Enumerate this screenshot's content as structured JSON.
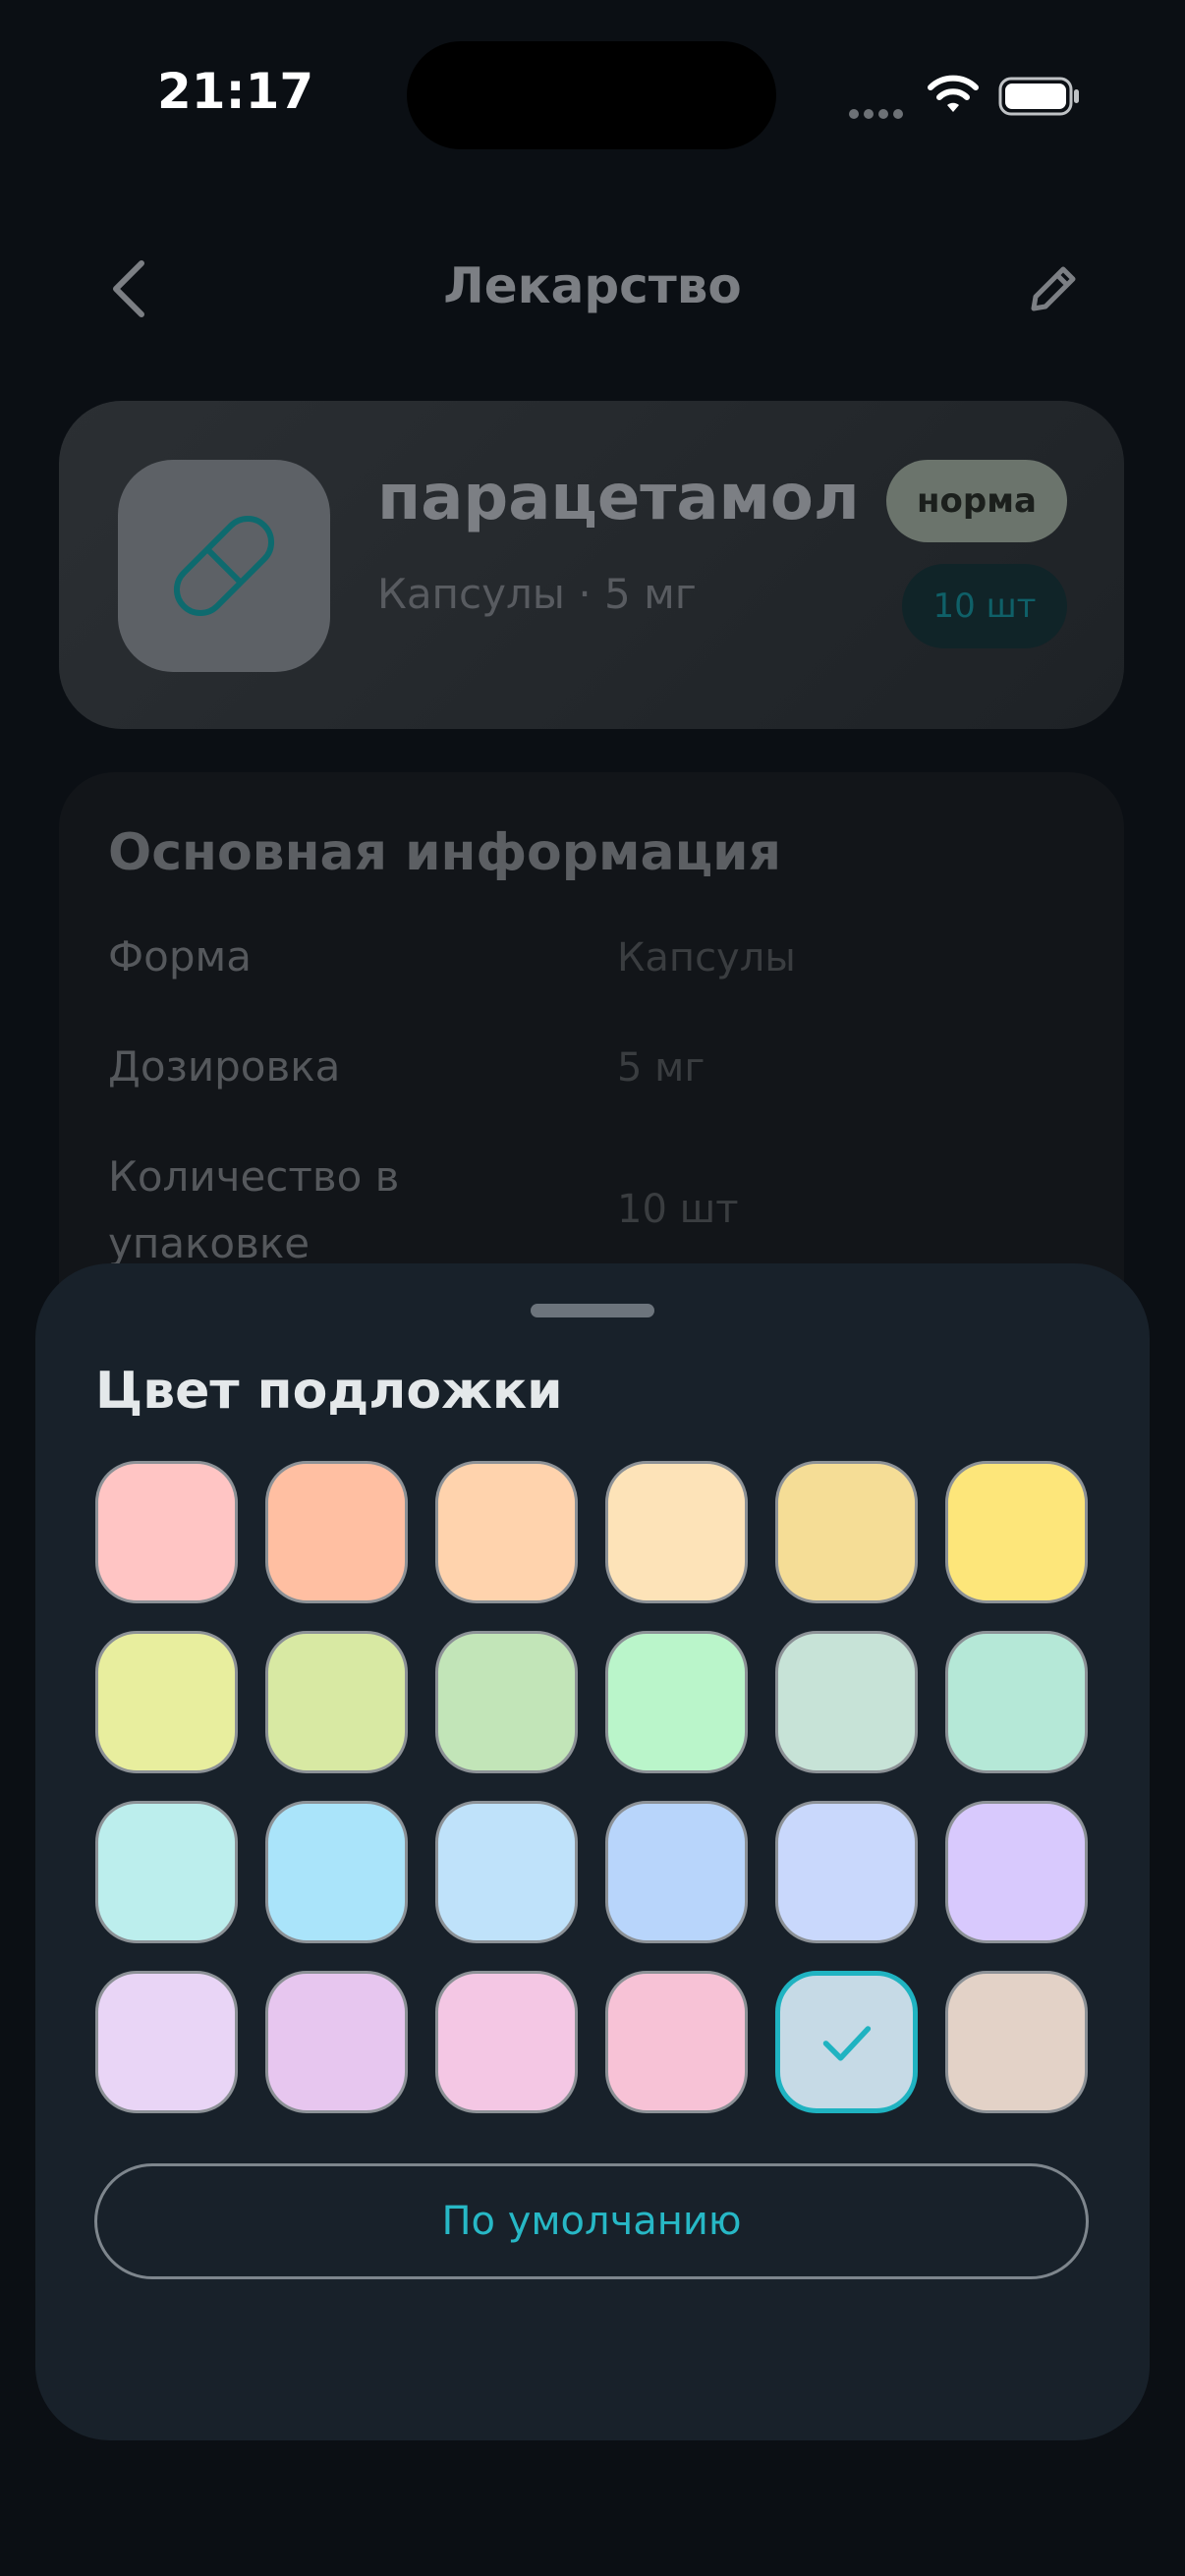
{
  "status": {
    "time": "21:17"
  },
  "nav": {
    "title": "Лекарство"
  },
  "medicine": {
    "name": "парацетамол",
    "subtitle": "Капсулы · 5 мг",
    "status_badge": "норма",
    "quantity_badge": "10 шт"
  },
  "info": {
    "title": "Основная информация",
    "rows": [
      {
        "label": "Форма",
        "value": "Капсулы"
      },
      {
        "label": "Дозировка",
        "value": "5 мг"
      },
      {
        "label": "Количество в упаковке",
        "value": "10 шт"
      }
    ]
  },
  "sheet": {
    "title": "Цвет подложки",
    "selected_index": 22,
    "colors": [
      "#ffc5c4",
      "#ffbfa2",
      "#ffd3ad",
      "#fde3b8",
      "#f5dd96",
      "#fde67a",
      "#e8ee9e",
      "#d8e9a3",
      "#c2e5b8",
      "#baf5ca",
      "#c7e3d7",
      "#b5e8d7",
      "#bceeed",
      "#aae4fa",
      "#bfe2fa",
      "#b8d5fb",
      "#c9d8fc",
      "#d8c9fd",
      "#e9d5f6",
      "#e7c6ef",
      "#f4c7e4",
      "#f7c2d6",
      "#c6dae6",
      "#e3d2c7"
    ],
    "default_button": "По умолчанию"
  }
}
